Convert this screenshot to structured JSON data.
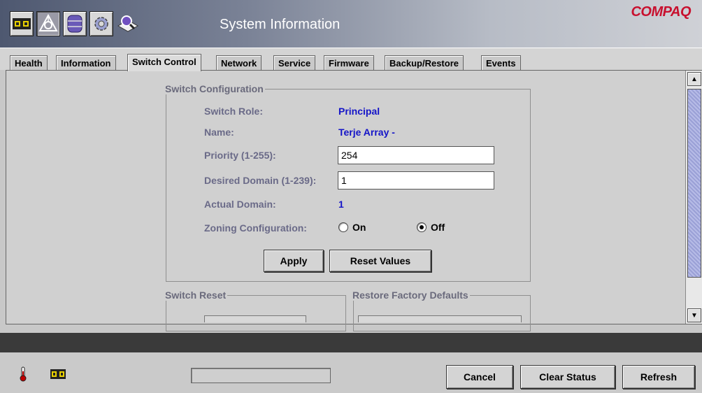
{
  "header": {
    "title": "System Information",
    "logo": "COMPAQ",
    "toolbar": [
      {
        "icon": "switch-ports-icon"
      },
      {
        "icon": "fabric-topology-icon"
      },
      {
        "icon": "database-icon"
      },
      {
        "icon": "gear-icon"
      },
      {
        "icon": "magnifier-help-icon"
      }
    ]
  },
  "tabs": [
    "Health",
    "Information",
    "Switch Control",
    "Network",
    "Service",
    "Firmware",
    "Backup/Restore",
    "Events"
  ],
  "selected_tab": "Switch Control",
  "switch_config": {
    "legend": "Switch Configuration",
    "role_label": "Switch Role:",
    "role_value": "Principal",
    "name_label": "Name:",
    "name_value": "Terje Array -",
    "priority_label": "Priority (1-255):",
    "priority_value": "254",
    "domain_label": "Desired Domain (1-239):",
    "domain_value": "1",
    "actual_label": "Actual Domain:",
    "actual_value": "1",
    "zoning_label": "Zoning Configuration:",
    "zoning_on": "On",
    "zoning_off": "Off",
    "zoning_selected": "Off",
    "apply": "Apply",
    "reset_values": "Reset Values"
  },
  "switch_reset": {
    "legend": "Switch Reset"
  },
  "factory_defaults": {
    "legend": "Restore Factory Defaults"
  },
  "footer": {
    "cancel": "Cancel",
    "clear_status": "Clear Status",
    "refresh": "Refresh",
    "status_icons": [
      "thermometer-icon",
      "switch-ports-icon"
    ]
  },
  "colors": {
    "label": "#6a6a88",
    "value": "#1414c8",
    "logo": "#c8102e"
  }
}
